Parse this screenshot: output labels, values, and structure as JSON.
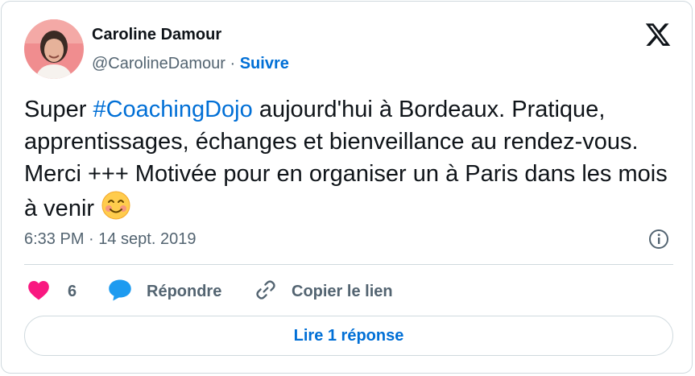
{
  "author": {
    "name": "Caroline Damour",
    "handle": "@CarolineDamour",
    "separator": " · ",
    "follow_label": "Suivre"
  },
  "tweet": {
    "text_before": "Super ",
    "hashtag": "#CoachingDojo",
    "text_after": " aujourd'hui à Bordeaux. Pratique, apprentissages, échanges et bienveillance au rendez-vous. Merci +++ Motivée pour en organiser un à Paris dans les mois à venir ",
    "timestamp": "6:33 PM · 14 sept. 2019"
  },
  "actions": {
    "like_count": "6",
    "reply_label": "Répondre",
    "copy_label": "Copier le lien"
  },
  "read_replies_label": "Lire 1 réponse",
  "colors": {
    "link": "#006fd6",
    "like": "#f91880",
    "reply": "#1d9bf0",
    "muted": "#536471",
    "border": "#cfd9de"
  },
  "icons": [
    "x-logo-icon",
    "info-icon",
    "heart-icon",
    "speech-bubble-icon",
    "link-icon",
    "smiling-face-emoji"
  ]
}
